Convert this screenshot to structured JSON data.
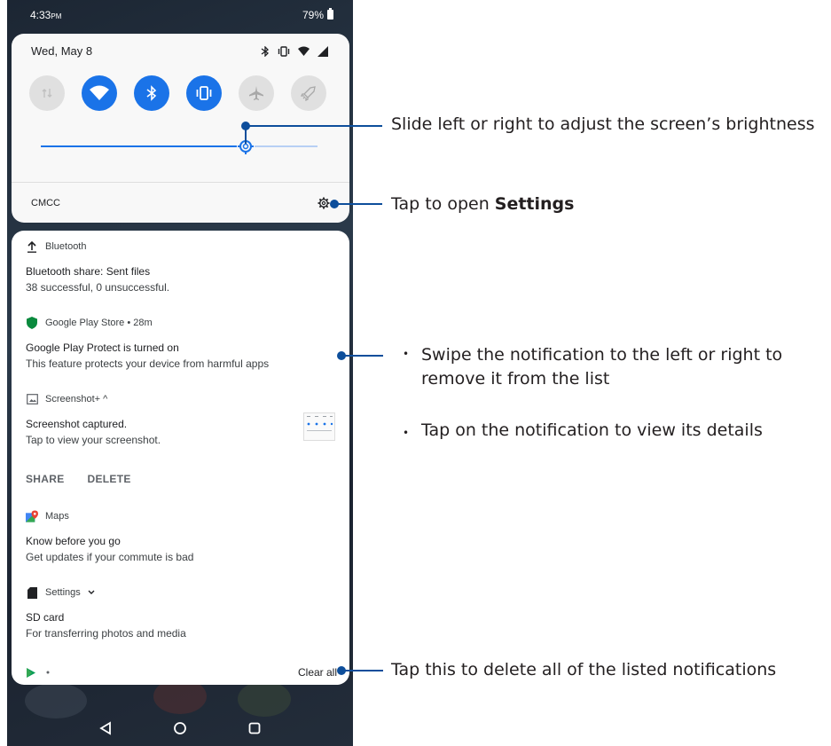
{
  "status_bar": {
    "time": "4:33",
    "ampm": "PM",
    "battery": "79%"
  },
  "quick_settings": {
    "date": "Wed, May 8",
    "carrier": "CMCC",
    "brightness_level": 0.74,
    "tiles": [
      {
        "icon": "mobile-data-icon",
        "state": "off"
      },
      {
        "icon": "wifi-icon",
        "state": "on"
      },
      {
        "icon": "bluetooth-icon",
        "state": "on"
      },
      {
        "icon": "vibrate-icon",
        "state": "on"
      },
      {
        "icon": "airplane-icon",
        "state": "off"
      },
      {
        "icon": "rocket-icon",
        "state": "off"
      }
    ]
  },
  "notifications": [
    {
      "app": "Bluetooth",
      "title": "Bluetooth share: Sent files",
      "text": "38 successful, 0 unsuccessful."
    },
    {
      "app": "Google Play Store • 28m",
      "title": "Google Play Protect is turned on",
      "text": "This feature protects your device from harmful apps"
    },
    {
      "app": "Screenshot+ ^",
      "title": "Screenshot captured.",
      "text": "Tap to view your screenshot.",
      "actions": [
        "SHARE",
        "DELETE"
      ]
    },
    {
      "app": "Maps",
      "title": "Know before you go",
      "text": "Get updates if your commute is bad"
    },
    {
      "app": "Settings",
      "title": "SD card",
      "text": "For transferring photos and media"
    }
  ],
  "footer": {
    "clear_all": "Clear all"
  },
  "callouts": {
    "brightness": "Slide left or right to adjust the screen’s brightness",
    "settings_prefix": "Tap to open ",
    "settings_bold": "Settings",
    "swipe": "Swipe the notification to the left or right to remove it from the list",
    "swipe_line1": "Swipe the notification to the left or right to",
    "swipe_line2": "remove it from the list",
    "tap": "Tap on the notification to view its details",
    "clear": "Tap this to delete all of the listed notifications"
  },
  "colors": {
    "accent": "#1a73e8",
    "callout": "#0d4e9b"
  }
}
